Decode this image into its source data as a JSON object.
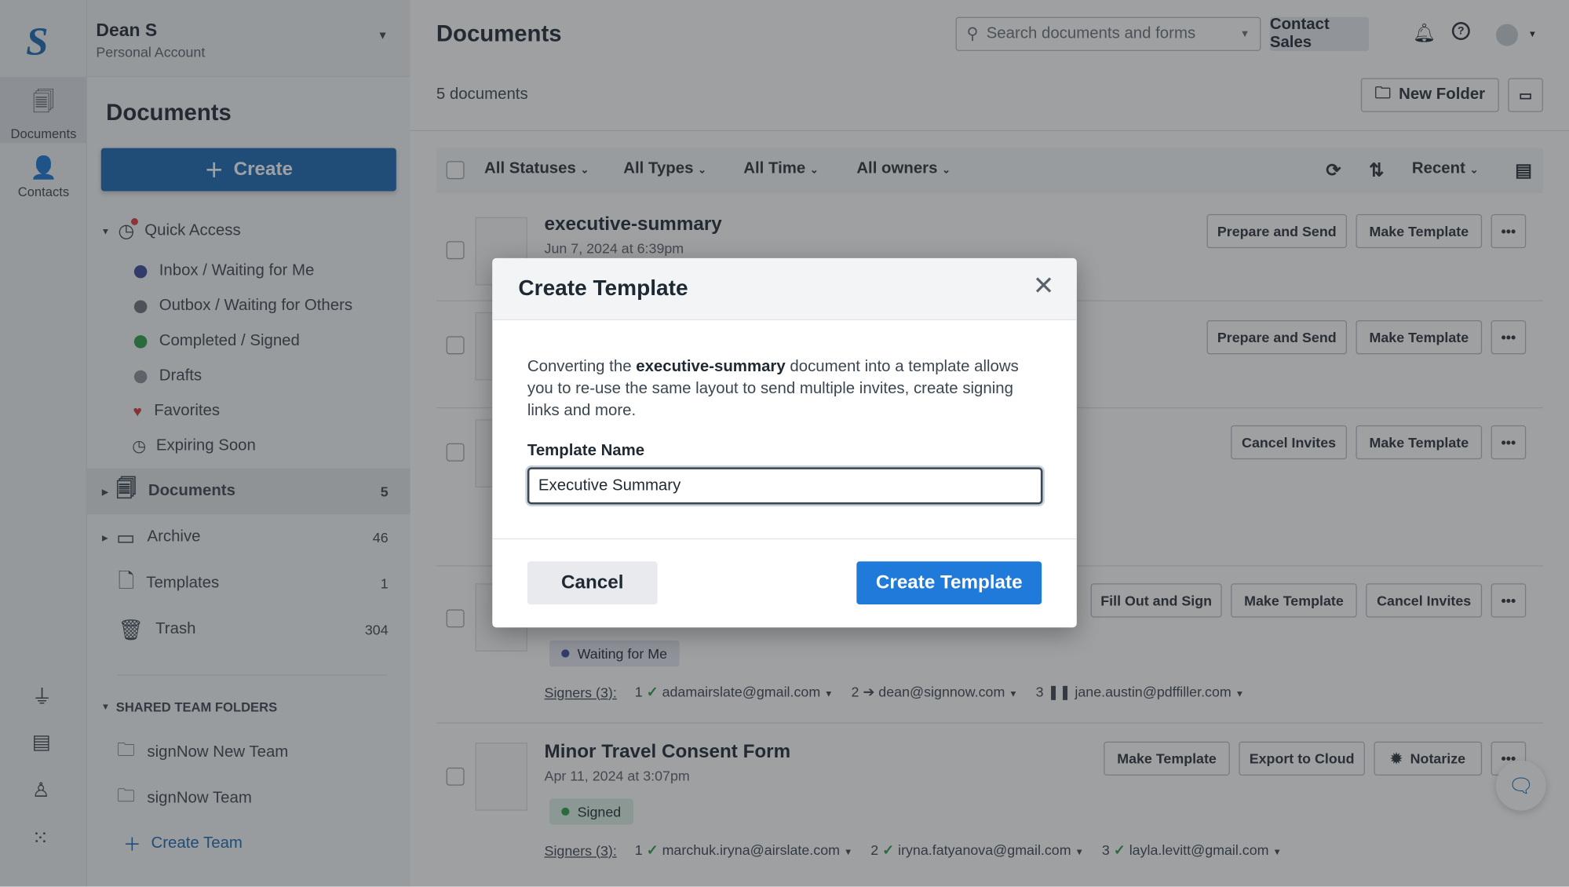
{
  "rail": {
    "items": [
      {
        "label": "Documents",
        "icon": "documents-icon"
      },
      {
        "label": "Contacts",
        "icon": "contacts-icon"
      }
    ],
    "bottom_icons": [
      "plug-icon",
      "table-icon",
      "user-signature-icon",
      "apps-grid-icon"
    ]
  },
  "account": {
    "name": "Dean S",
    "type": "Personal Account"
  },
  "sidebar": {
    "title": "Documents",
    "create_label": "Create",
    "quick_access": "Quick Access",
    "quick_items": [
      {
        "label": "Inbox / Waiting for Me",
        "color": "#3b4a9a"
      },
      {
        "label": "Outbox / Waiting for Others",
        "color": "#6b7177"
      },
      {
        "label": "Completed / Signed",
        "color": "#2e9d47"
      },
      {
        "label": "Drafts",
        "color": "#8a9097"
      },
      {
        "label": "Favorites",
        "color": "#d63a3a"
      },
      {
        "label": "Expiring Soon",
        "color": "#6b7177"
      }
    ],
    "folders": [
      {
        "label": "Documents",
        "count": "5"
      },
      {
        "label": "Archive",
        "count": "46"
      },
      {
        "label": "Templates",
        "count": "1"
      },
      {
        "label": "Trash",
        "count": "304"
      }
    ],
    "shared_header": "SHARED TEAM FOLDERS",
    "teams": [
      "signNow New Team",
      "signNow Team"
    ],
    "create_team": "Create Team"
  },
  "header": {
    "title": "Documents",
    "search_placeholder": "Search documents and forms",
    "contact_sales": "Contact Sales"
  },
  "toolbar": {
    "count": "5 documents",
    "new_folder": "New Folder"
  },
  "filters": {
    "statuses": "All Statuses",
    "types": "All Types",
    "time": "All Time",
    "owners": "All owners",
    "sort": "Recent"
  },
  "documents": [
    {
      "title": "executive-summary",
      "date": "Jun 7, 2024 at 6:39pm",
      "actions": [
        "Prepare and Send",
        "Make Template"
      ]
    },
    {
      "actions": [
        "Prepare and Send",
        "Make Template"
      ]
    },
    {
      "actions": [
        "Cancel Invites",
        "Make Template"
      ]
    },
    {
      "actions": [
        "Fill Out and Sign",
        "Make Template",
        "Cancel Invites"
      ],
      "status": "Waiting for Me",
      "signers_label": "Signers (3):",
      "signers": [
        {
          "n": "1",
          "state": "signed",
          "email": "adamairslate@gmail.com"
        },
        {
          "n": "2",
          "state": "pending",
          "email": "dean@signnow.com"
        },
        {
          "n": "3",
          "state": "paused",
          "email": "jane.austin@pdffiller.com"
        }
      ]
    },
    {
      "title": "Minor Travel Consent Form",
      "date": "Apr 11, 2024 at 3:07pm",
      "actions": [
        "Make Template",
        "Export to Cloud",
        "Notarize"
      ],
      "status": "Signed",
      "signers_label": "Signers (3):",
      "signers": [
        {
          "n": "1",
          "state": "signed",
          "email": "marchuk.iryna@airslate.com"
        },
        {
          "n": "2",
          "state": "signed",
          "email": "iryna.fatyanova@gmail.com"
        },
        {
          "n": "3",
          "state": "signed",
          "email": "layla.levitt@gmail.com"
        }
      ]
    }
  ],
  "modal": {
    "title": "Create Template",
    "text_before": "Converting the ",
    "doc_name": "executive-summary",
    "text_after": " document into a template allows you to re-use the same layout to send multiple invites, create signing links and more.",
    "field_label": "Template Name",
    "field_value": "Executive Summary",
    "cancel": "Cancel",
    "submit": "Create Template"
  },
  "colors": {
    "accent": "#1f7ad9",
    "brand": "#1b68b3"
  }
}
